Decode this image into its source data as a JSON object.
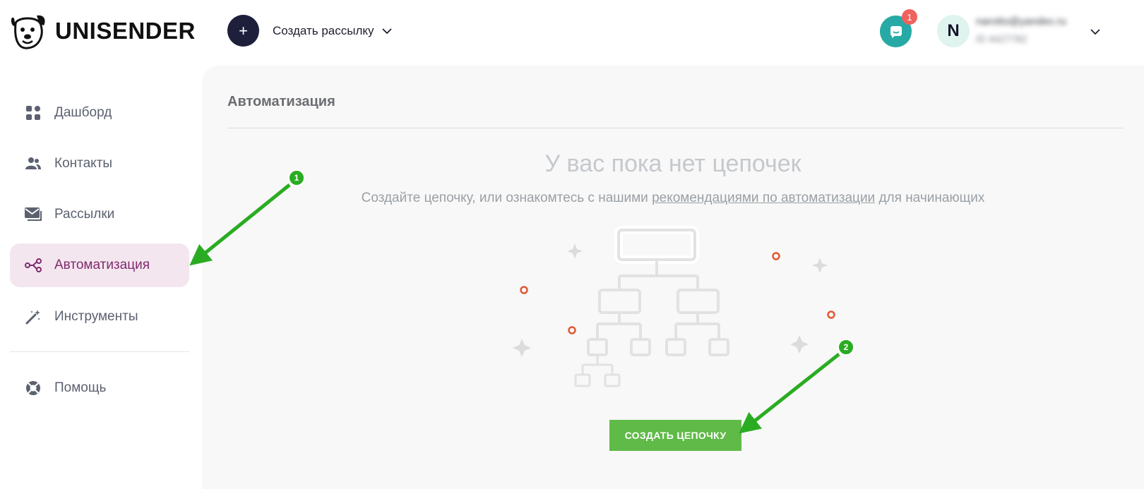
{
  "brand": {
    "name": "UNISENDER"
  },
  "header": {
    "create_button_icon": "plus-icon",
    "create_label": "Создать рассылку",
    "chat_badge": "1",
    "avatar_letter": "N",
    "account_email": "narotto@yandex.ru",
    "account_id": "ID 4427782"
  },
  "sidebar": {
    "items": [
      {
        "label": "Дашборд",
        "icon": "dashboard-grid-icon",
        "active": false
      },
      {
        "label": "Контакты",
        "icon": "people-icon",
        "active": false
      },
      {
        "label": "Рассылки",
        "icon": "mail-icon",
        "active": false
      },
      {
        "label": "Автоматизация",
        "icon": "automation-flow-icon",
        "active": true
      },
      {
        "label": "Инструменты",
        "icon": "magic-wand-icon",
        "active": false
      }
    ],
    "help_label": "Помощь",
    "help_icon": "lifebuoy-icon"
  },
  "main": {
    "title": "Автоматизация",
    "empty_title": "У вас пока нет цепочек",
    "empty_sub_before": "Создайте цепочку, или ознакомтесь с нашими ",
    "empty_sub_link": "рекомендациями по автоматизации",
    "empty_sub_after": " для начинающих",
    "create_chain_label": "СОЗДАТЬ ЦЕПОЧКУ"
  },
  "annotations": {
    "step1": "1",
    "step2": "2"
  },
  "colors": {
    "accent_dark": "#1e1f3b",
    "chat": "#27aaa5",
    "badge": "#f0625d",
    "active_bg": "#f4e6ee",
    "active_text": "#7e2a6e",
    "cta": "#5fba47",
    "arrow": "#2aac22"
  }
}
